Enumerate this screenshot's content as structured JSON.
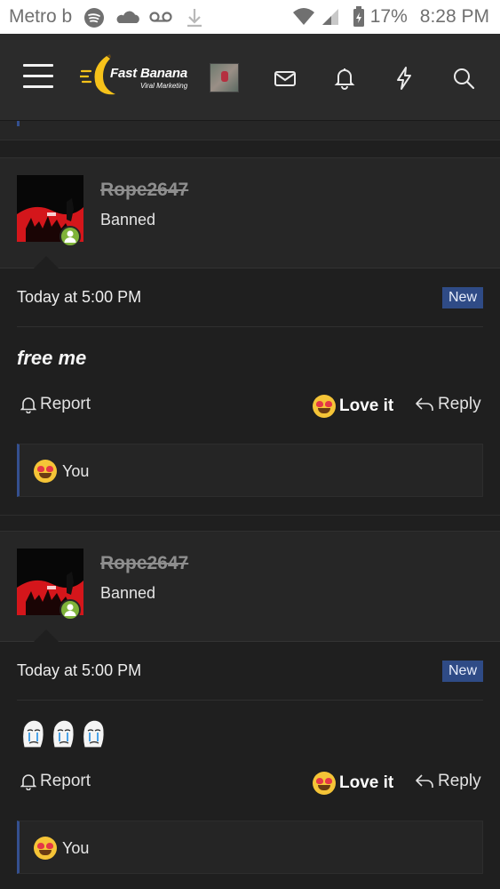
{
  "status_bar": {
    "carrier": "Metro b",
    "battery": "17%",
    "time": "8:28 PM"
  },
  "header": {
    "logo_title": "Fast Banana",
    "logo_subtitle": "Viral Marketing",
    "icons": [
      "menu-icon",
      "mail-icon",
      "bell-icon",
      "lightning-icon",
      "search-icon"
    ]
  },
  "posts": [
    {
      "username": "Rope2647",
      "user_title": "Banned",
      "date": "Today at 5:00 PM",
      "badge": "New",
      "message": "free me",
      "actions": {
        "report": "Report",
        "love": "Love it",
        "reply": "Reply"
      },
      "reactions_label": "You"
    },
    {
      "username": "Rope2647",
      "user_title": "Banned",
      "date": "Today at 5:00 PM",
      "badge": "New",
      "message_emojis": [
        "crying-wojak-emoji",
        "crying-wojak-emoji",
        "crying-wojak-emoji"
      ],
      "actions": {
        "report": "Report",
        "love": "Love it",
        "reply": "Reply"
      },
      "reactions_label": "You"
    }
  ],
  "colors": {
    "accent_blue": "#2f4b86",
    "online_green": "#7fb33a",
    "banana_yellow": "#f6c21a"
  }
}
